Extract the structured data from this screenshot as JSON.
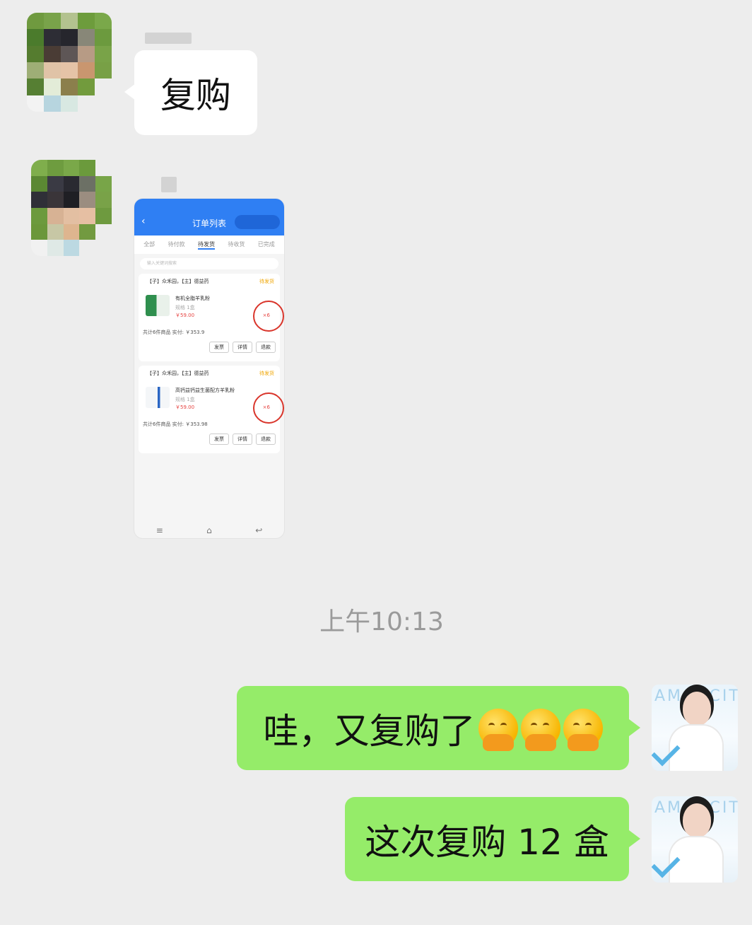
{
  "messages": {
    "incoming_1_text": "复购",
    "timestamp": "上午10:13",
    "outgoing_1_text": "哇，又复购了",
    "outgoing_1_emoji": [
      "shy-face-emoji",
      "shy-face-emoji",
      "shy-face-emoji"
    ],
    "outgoing_2_text": "这次复购 12 盒"
  },
  "avatar_brand": "AMORCITY",
  "order_screenshot": {
    "title": "订单列表",
    "back": "‹",
    "tabs": [
      "全部",
      "待付款",
      "待发货",
      "待收货",
      "已完成"
    ],
    "active_tab_index": 2,
    "search_placeholder": "输入关键词搜索",
    "orders": [
      {
        "shop": "【子】众禾园，【主】德益药",
        "status": "待发货",
        "product": "有机全脂羊乳粉",
        "spec": "规格 1盒",
        "price": "￥59.00",
        "qty": "×6",
        "total": "共计6件商品 实付: ￥353.9",
        "buttons": [
          "发票",
          "详情",
          "退款"
        ]
      },
      {
        "shop": "【子】众禾园，【主】德益药",
        "status": "待发货",
        "product": "高钙益钙益生菌配方羊乳粉",
        "spec": "规格 1盒",
        "price": "￥59.00",
        "qty": "×6",
        "total": "共计6件商品 实付: ￥353.98",
        "buttons": [
          "发票",
          "详情",
          "退款"
        ]
      }
    ],
    "nav": [
      "≡",
      "⌂",
      "↩"
    ]
  },
  "colors": {
    "background": "#ededed",
    "incoming_bubble": "#ffffff",
    "outgoing_bubble": "#95ec69",
    "accent_blue": "#2f7ff3",
    "mark_red": "#d9352b"
  }
}
